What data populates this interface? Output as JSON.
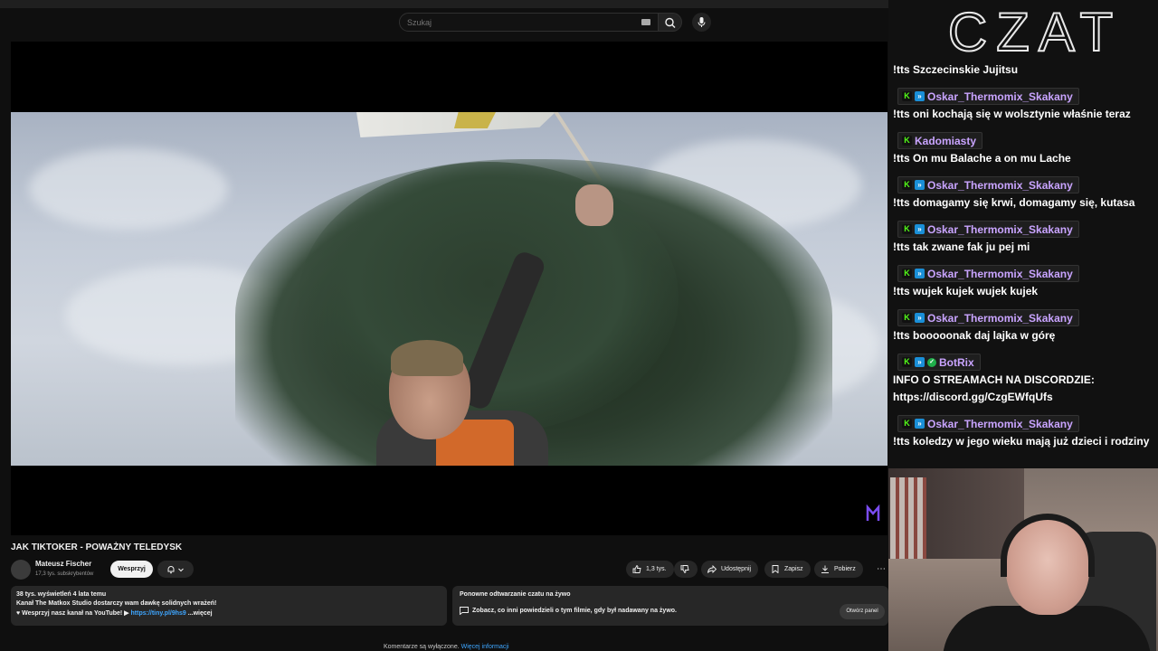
{
  "search": {
    "placeholder": "Szukaj"
  },
  "video": {
    "title": "JAK TIKTOKER - POWAŻNY TELEDYSK",
    "channel_name": "Mateusz Fischer",
    "subscribers": "17,3 tys. subskrybentów",
    "support_label": "Wesprzyj",
    "like_count": "1,3 tys.",
    "share_label": "Udostępnij",
    "save_label": "Zapisz",
    "download_label": "Pobierz",
    "more_label": "⋯"
  },
  "description": {
    "meta": "38 tys. wyświetleń  4 lata temu",
    "line1": "Kanał The Matkox Studio dostarczy wam dawkę solidnych wrażeń!",
    "line2_prefix": "♥ Wesprzyj nasz kanał na YouTube! ▶ ",
    "line2_link": "https://tiny.pl/9hs9",
    "line2_more": " ...więcej"
  },
  "chat_replay": {
    "title": "Ponowne odtwarzanie czatu na żywo",
    "text": "Zobacz, co inni powiedzieli o tym filmie, gdy był nadawany na żywo.",
    "open_panel_label": "Otwórz panel"
  },
  "comments": {
    "disabled_text": "Komentarze są wyłączone. ",
    "more_info_label": "Więcej informacji"
  },
  "chat": {
    "title": "CZAT",
    "username_color": "#c9a4ff",
    "kick_color": "#53fc18",
    "messages": [
      {
        "user": "",
        "badges": [],
        "text": "!tts Szczecinskie Jujitsu"
      },
      {
        "user": "Oskar_Thermomix_Skakany",
        "badges": [
          "kick-badge",
          "boost-badge"
        ],
        "text": "!tts oni kochają się w wolsztynie właśnie teraz"
      },
      {
        "user": "Kadomiasty",
        "badges": [
          "kick-badge"
        ],
        "text": "!tts On mu Balache a on mu Lache"
      },
      {
        "user": "Oskar_Thermomix_Skakany",
        "badges": [
          "kick-badge",
          "boost-badge"
        ],
        "text": "!tts domagamy się krwi, domagamy się, kutasa"
      },
      {
        "user": "Oskar_Thermomix_Skakany",
        "badges": [
          "kick-badge",
          "boost-badge"
        ],
        "text": "!tts tak zwane fak ju pej mi"
      },
      {
        "user": "Oskar_Thermomix_Skakany",
        "badges": [
          "kick-badge",
          "boost-badge"
        ],
        "text": "!tts wujek kujek wujek kujek"
      },
      {
        "user": "Oskar_Thermomix_Skakany",
        "badges": [
          "kick-badge",
          "boost-badge"
        ],
        "text": "!tts booooonak daj lajka w górę"
      },
      {
        "user": "BotRix",
        "badges": [
          "kick-badge",
          "boost-badge",
          "verified-badge"
        ],
        "text": "INFO O STREAMACH NA DISCORDZIE:",
        "text2": "https://discord.gg/CzgEWfqUfs"
      },
      {
        "user": "Oskar_Thermomix_Skakany",
        "badges": [
          "kick-badge",
          "boost-badge"
        ],
        "text": "!tts koledzy w jego wieku mają już dzieci i rodziny"
      }
    ]
  }
}
